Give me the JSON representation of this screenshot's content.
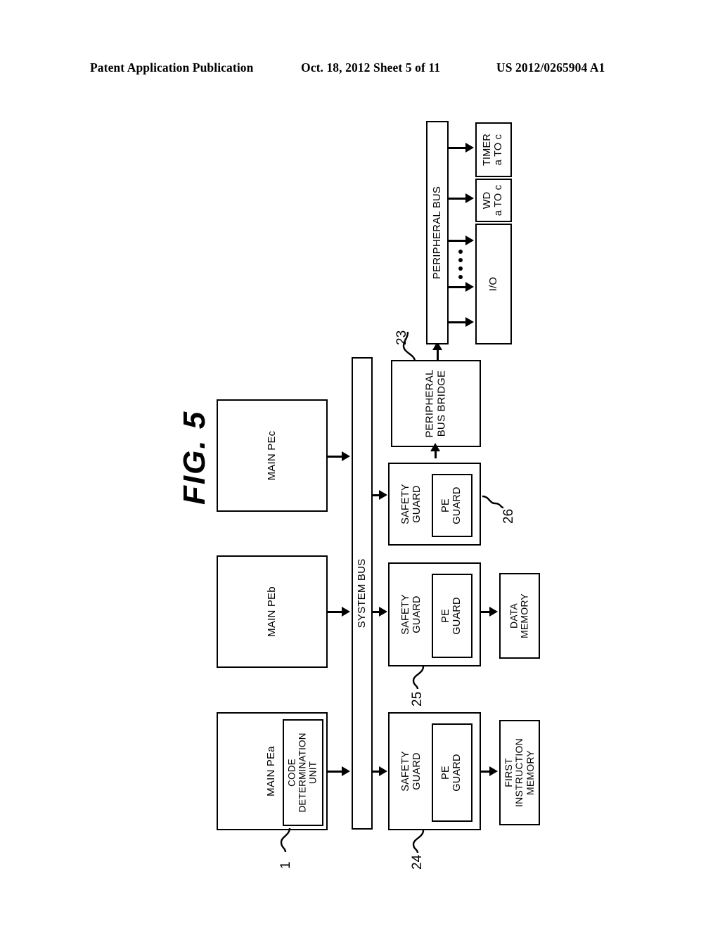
{
  "header": {
    "publication": "Patent Application Publication",
    "date_sheet": "Oct. 18, 2012   Sheet 5 of 11",
    "patent_number": "US 2012/0265904 A1"
  },
  "figure": {
    "title": "FIG. 5",
    "orientation": "landscape-rotated-90ccw"
  },
  "blocks": {
    "main_pe_a": "MAIN PEa",
    "main_pe_b": "MAIN PEb",
    "main_pe_c": "MAIN PEc",
    "code_determination_unit": "CODE\nDETERMINATION\nUNIT",
    "system_bus": "SYSTEM BUS",
    "safety_guard_a": "SAFETY\nGUARD",
    "safety_guard_b": "SAFETY\nGUARD",
    "safety_guard_c": "SAFETY\nGUARD",
    "pe_guard_a": "PE\nGUARD",
    "pe_guard_b": "PE\nGUARD",
    "pe_guard_c": "PE\nGUARD",
    "first_instruction_memory": "FIRST\nINSTRUCTION\nMEMORY",
    "data_memory": "DATA\nMEMORY",
    "peripheral_bus_bridge": "PERIPHERAL\nBUS BRIDGE",
    "peripheral_bus": "PERIPHERAL BUS",
    "timer": "TIMER\na TO c",
    "watchdog": "WD\na TO c",
    "io": "I/O"
  },
  "reference_numerals": {
    "code_determination_unit": "1",
    "peripheral_bus_bridge": "23",
    "safety_guard_a": "24",
    "safety_guard_b": "25",
    "safety_guard_c": "26"
  },
  "colors": {
    "ink": "#000000",
    "paper": "#ffffff"
  }
}
